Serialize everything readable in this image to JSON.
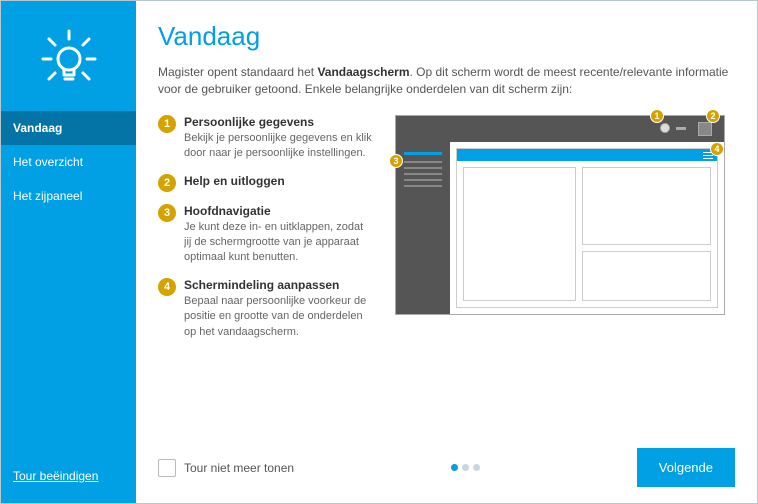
{
  "sidebar": {
    "nav": [
      {
        "label": "Vandaag",
        "active": true
      },
      {
        "label": "Het overzicht",
        "active": false
      },
      {
        "label": "Het zijpaneel",
        "active": false
      }
    ],
    "end_tour": "Tour beëindigen"
  },
  "page": {
    "title": "Vandaag",
    "intro_pre": "Magister opent standaard het ",
    "intro_bold": "Vandaagscherm",
    "intro_post": ". Op dit scherm wordt de meest recente/relevante informatie voor de gebruiker getoond. Enkele belangrijke onderdelen van dit scherm zijn:"
  },
  "items": [
    {
      "n": "1",
      "title": "Persoonlijke gegevens",
      "desc": "Bekijk je persoonlijke gegevens en klik door naar je persoonlijke instellingen."
    },
    {
      "n": "2",
      "title": "Help en uitloggen",
      "desc": ""
    },
    {
      "n": "3",
      "title": "Hoofdnavigatie",
      "desc": "Je kunt deze in- en uitklappen, zodat jij de schermgrootte van je apparaat optimaal kunt benutten."
    },
    {
      "n": "4",
      "title": "Schermindeling aanpassen",
      "desc": "Bepaal naar persoonlijke voorkeur de positie en grootte van de onderdelen op het vandaagscherm."
    }
  ],
  "footer": {
    "checkbox_label": "Tour niet meer tonen",
    "next": "Volgende",
    "page_index": 0,
    "page_count": 3
  },
  "markers": {
    "m1": "1",
    "m2": "2",
    "m3": "3",
    "m4": "4"
  }
}
